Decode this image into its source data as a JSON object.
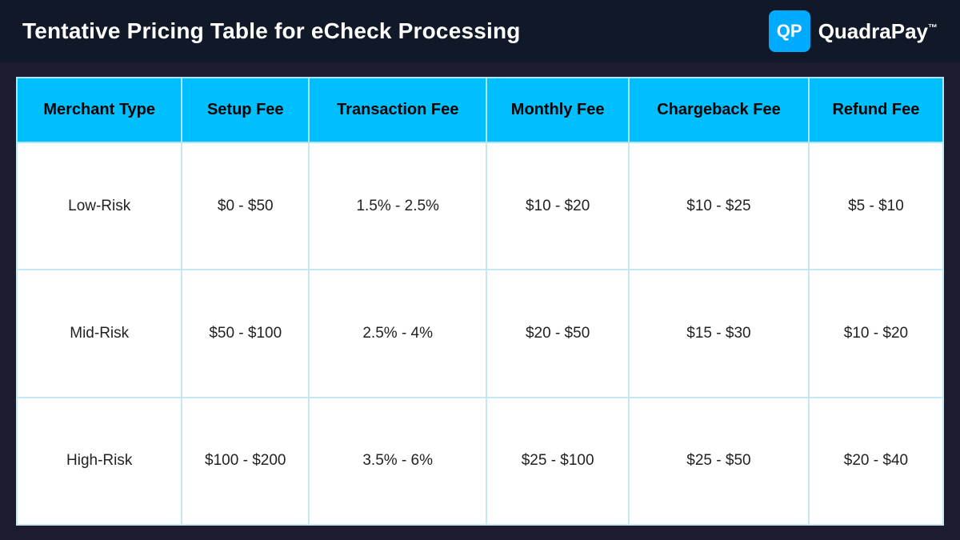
{
  "header": {
    "title": "Tentative Pricing Table for eCheck Processing",
    "logo_icon": "QP",
    "logo_name": "QuadraPay",
    "logo_tm": "™"
  },
  "table": {
    "columns": [
      "Merchant Type",
      "Setup Fee",
      "Transaction Fee",
      "Monthly Fee",
      "Chargeback Fee",
      "Refund Fee"
    ],
    "rows": [
      {
        "merchant_type": "Low-Risk",
        "setup_fee": "$0 - $50",
        "transaction_fee": "1.5% - 2.5%",
        "monthly_fee": "$10 - $20",
        "chargeback_fee": "$10 - $25",
        "refund_fee": "$5 - $10"
      },
      {
        "merchant_type": "Mid-Risk",
        "setup_fee": "$50 - $100",
        "transaction_fee": "2.5% - 4%",
        "monthly_fee": "$20 - $50",
        "chargeback_fee": "$15 - $30",
        "refund_fee": "$10 - $20"
      },
      {
        "merchant_type": "High-Risk",
        "setup_fee": "$100 - $200",
        "transaction_fee": "3.5% - 6%",
        "monthly_fee": "$25 - $100",
        "chargeback_fee": "$25 - $50",
        "refund_fee": "$20 - $40"
      }
    ]
  }
}
